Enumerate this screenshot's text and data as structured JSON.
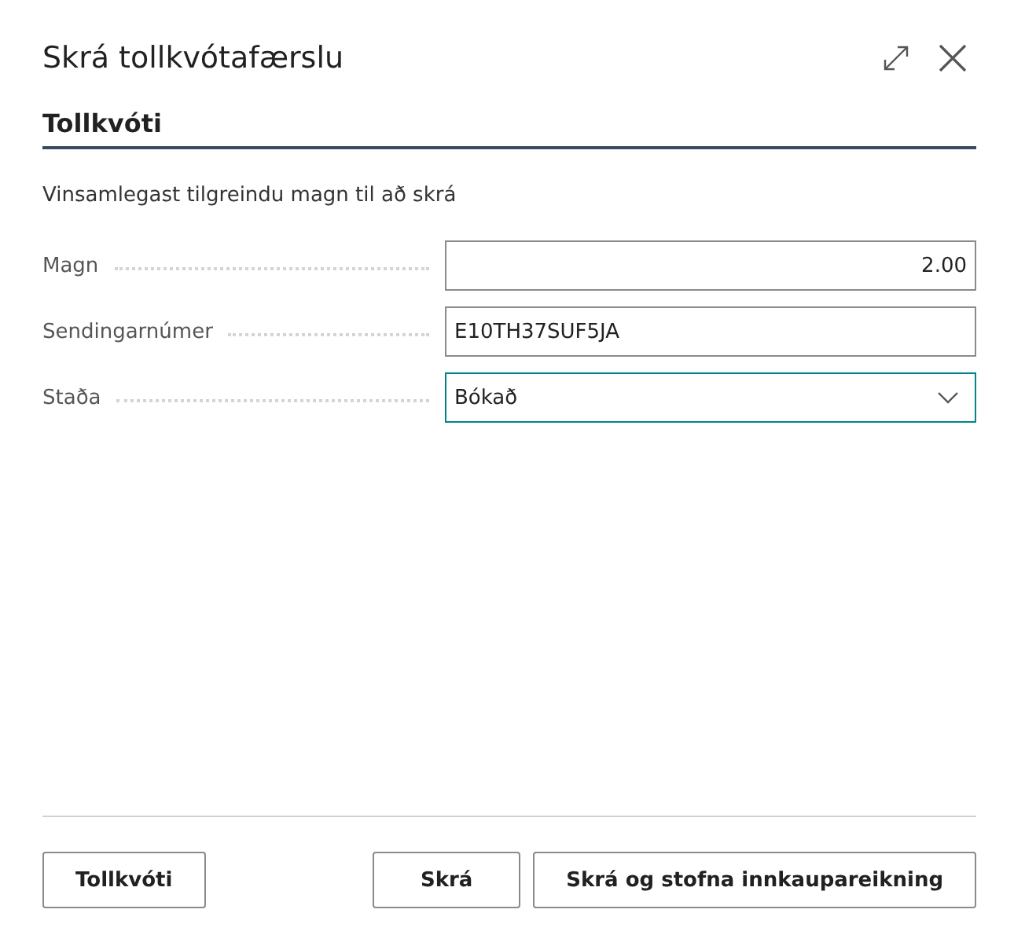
{
  "dialog": {
    "title": "Skrá tollkvótafærslu"
  },
  "section": {
    "title": "Tollkvóti"
  },
  "instruction": "Vinsamlegast tilgreindu magn til að skrá",
  "fields": [
    {
      "kind": "number",
      "label": "Magn",
      "value": "2.00",
      "focused": false
    },
    {
      "kind": "text",
      "label": "Sendingarnúmer",
      "value": "E10TH37SUF5JA",
      "focused": false
    },
    {
      "kind": "select",
      "label": "Staða",
      "value": "Bókað",
      "focused": true
    }
  ],
  "footer_left_buttons": [
    "Tollkvóti"
  ],
  "footer_right_buttons": [
    "Skrá",
    "Skrá og stofna innkaupareikning"
  ]
}
